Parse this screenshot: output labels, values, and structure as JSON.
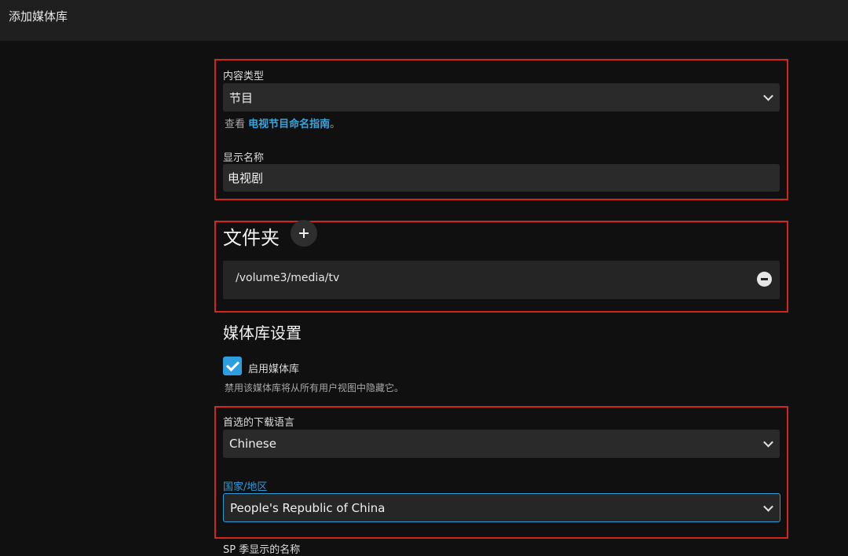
{
  "window": {
    "title": "添加媒体库"
  },
  "content_type": {
    "label": "内容类型",
    "value": "节目",
    "hint_prefix": "查看 ",
    "hint_link": "电视节目命名指南",
    "hint_suffix": "。"
  },
  "display_name": {
    "label": "显示名称",
    "value": "电视剧"
  },
  "folders": {
    "title": "文件夹",
    "items": [
      {
        "path": "/volume3/media/tv"
      }
    ]
  },
  "library_settings": {
    "title": "媒体库设置",
    "enable_label": "启用媒体库",
    "enable_checked": true,
    "enable_hint": "禁用该媒体库将从所有用户视图中隐藏它。"
  },
  "download_language": {
    "label": "首选的下载语言",
    "value": "Chinese"
  },
  "country": {
    "label": "国家/地区",
    "value": "People's Republic of China"
  },
  "special_season": {
    "label": "SP 季显示的名称"
  },
  "colors": {
    "accent": "#2f9cd6",
    "highlight_border": "#d0261d",
    "background": "#101010"
  }
}
